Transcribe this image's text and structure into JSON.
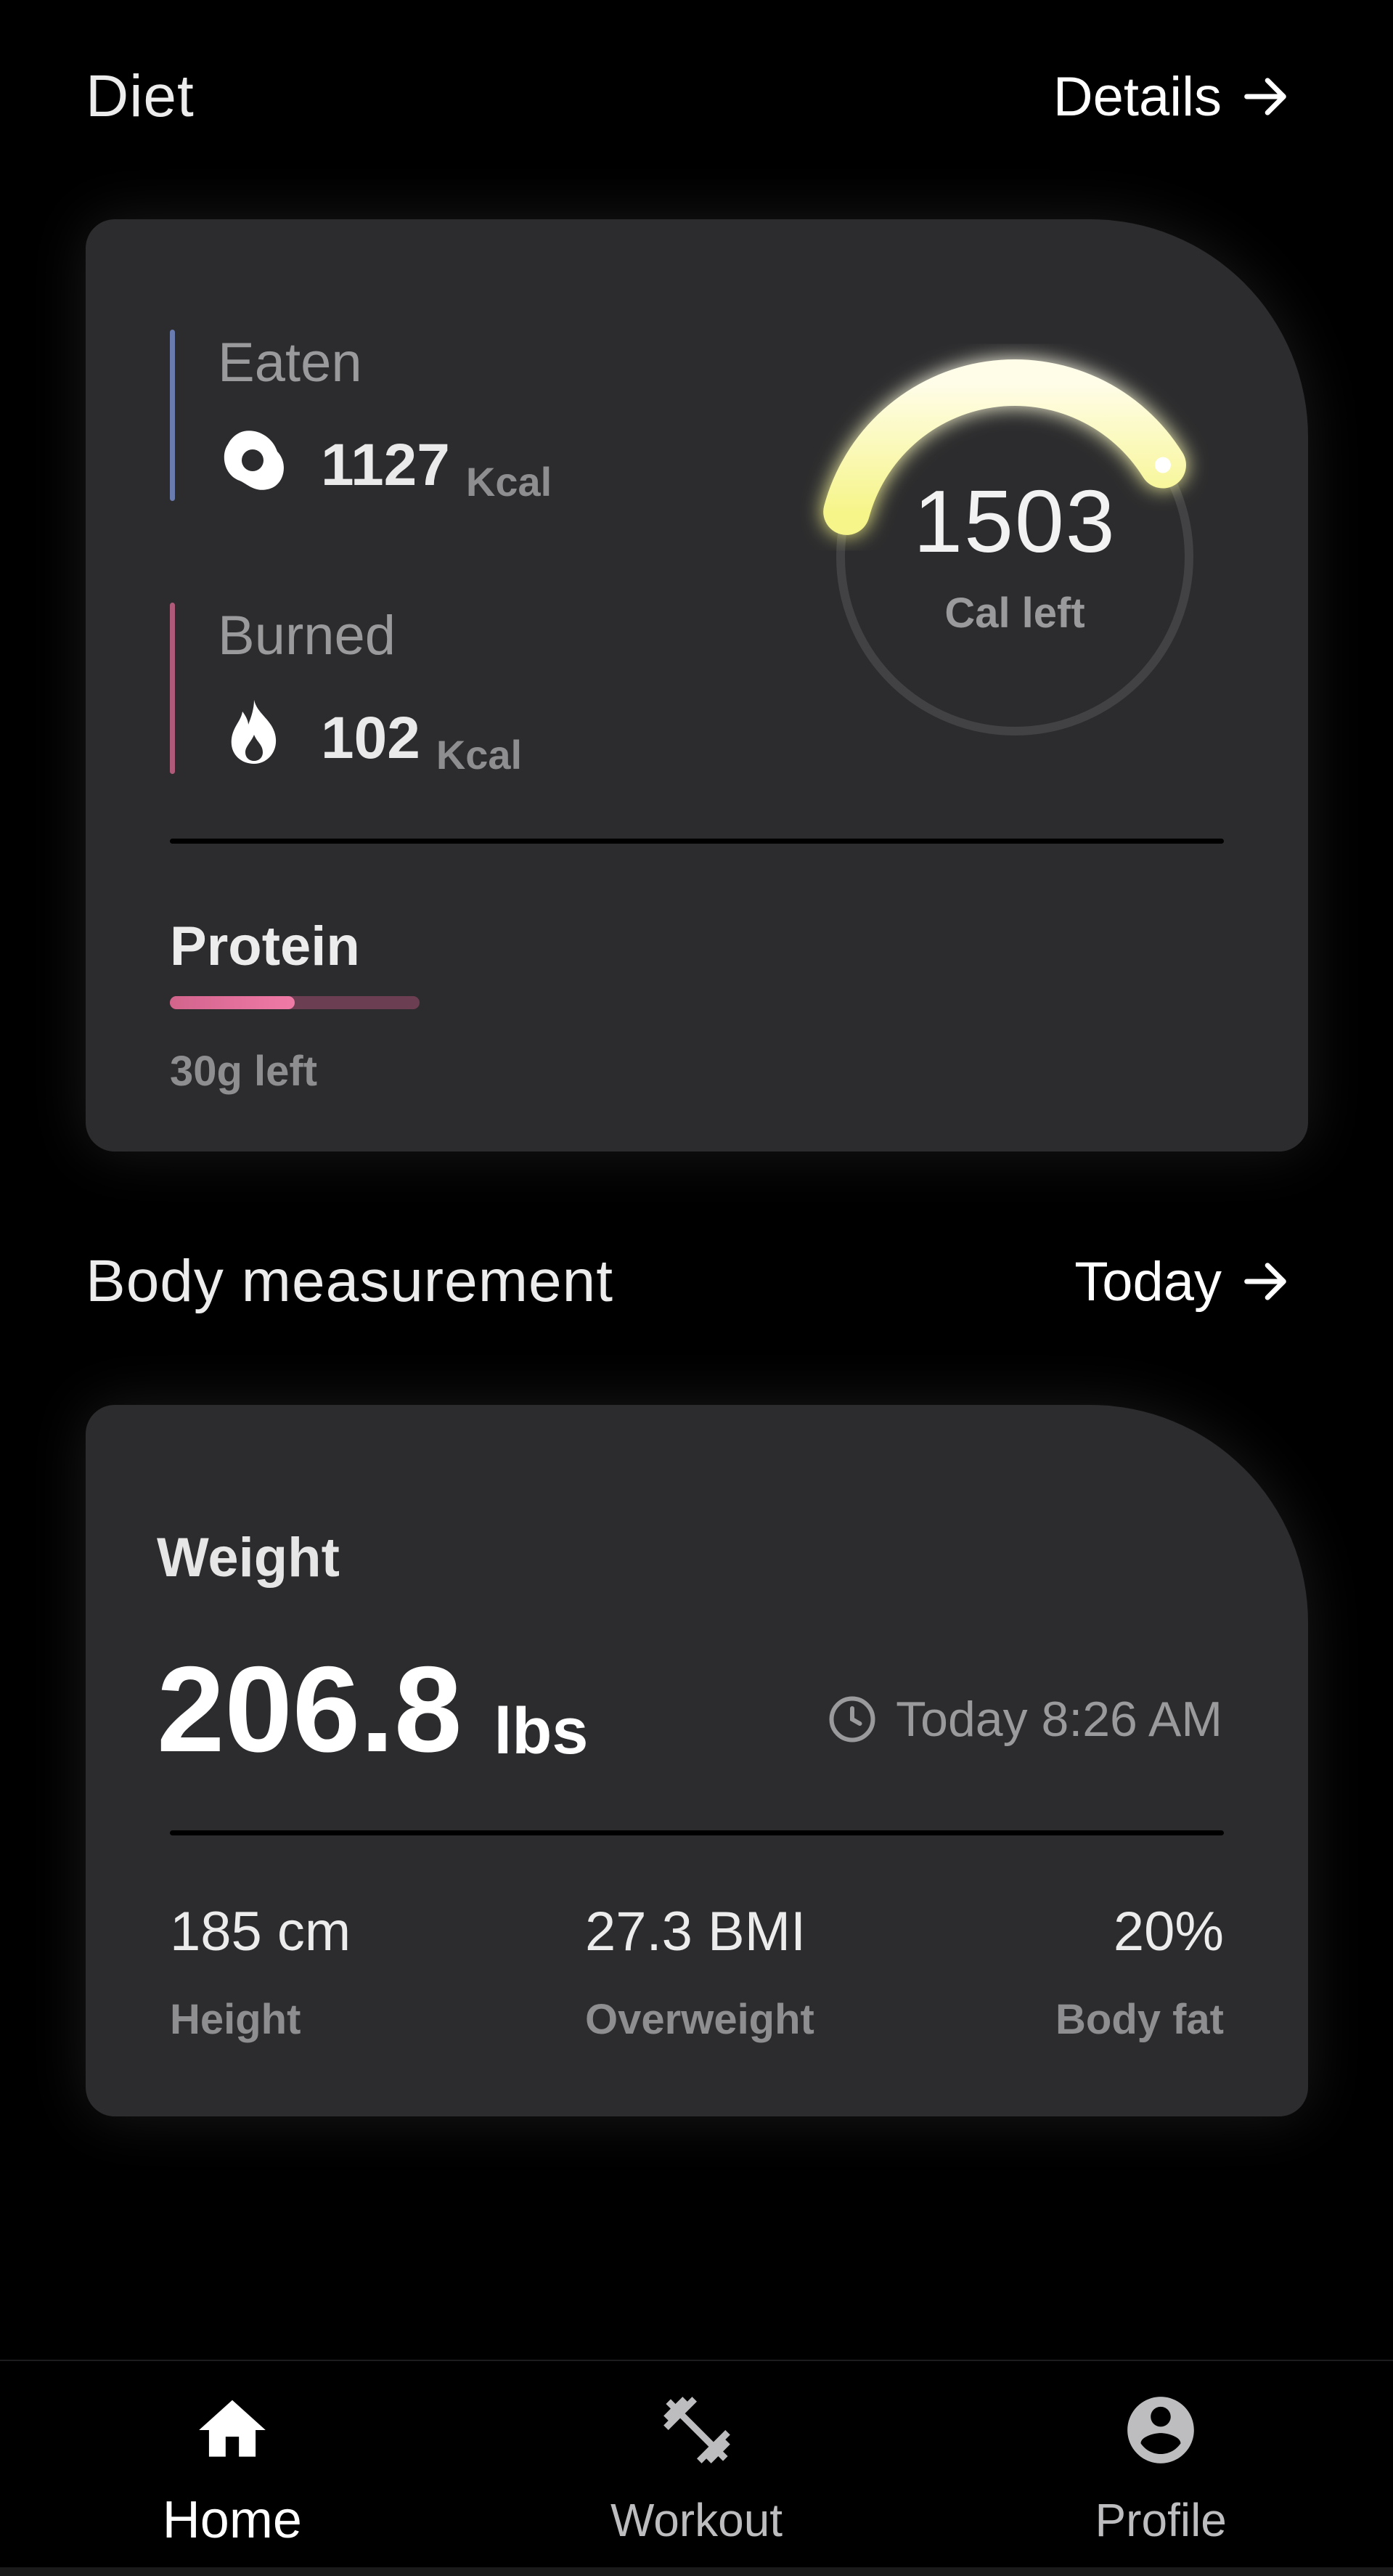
{
  "diet": {
    "title": "Diet",
    "link_label": "Details",
    "eaten": {
      "label": "Eaten",
      "value": "1127",
      "unit": "Kcal",
      "icon": "food-icon",
      "accent": "#6a7bb0"
    },
    "burned": {
      "label": "Burned",
      "value": "102",
      "unit": "Kcal",
      "icon": "flame-icon",
      "accent": "#b05a7a"
    },
    "ring": {
      "value": "1503",
      "label": "Cal left",
      "progress": 0.37,
      "color": "#fbfba0"
    },
    "protein": {
      "label": "Protein",
      "remaining": "30g left",
      "progress": 0.5,
      "color": "#e86f9b"
    }
  },
  "body": {
    "title": "Body measurement",
    "link_label": "Today",
    "weight_label": "Weight",
    "weight_value": "206.8",
    "weight_unit": "lbs",
    "timestamp": "Today 8:26 AM",
    "metrics": [
      {
        "value": "185 cm",
        "label": "Height"
      },
      {
        "value": "27.3 BMI",
        "label": "Overweight"
      },
      {
        "value": "20%",
        "label": "Body fat"
      }
    ]
  },
  "nav": {
    "items": [
      {
        "label": "Home",
        "icon": "home-icon",
        "active": true
      },
      {
        "label": "Workout",
        "icon": "dumbbell-icon",
        "active": false
      },
      {
        "label": "Profile",
        "icon": "profile-icon",
        "active": false
      }
    ]
  }
}
